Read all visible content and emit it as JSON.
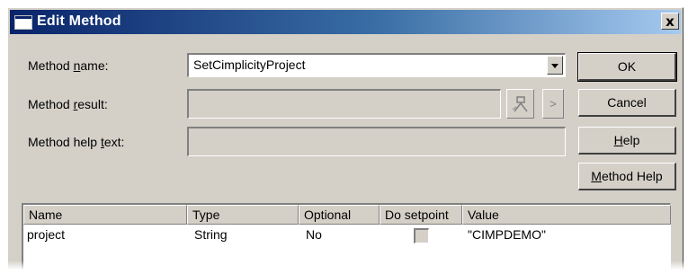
{
  "window": {
    "title": "Edit Method",
    "close_label": "x"
  },
  "form": {
    "method_name": {
      "label_pre": "Method ",
      "label_u": "n",
      "label_post": "ame:",
      "value": "SetCimplicityProject"
    },
    "method_result": {
      "label_pre": "Method ",
      "label_u": "r",
      "label_post": "esult:",
      "value": ""
    },
    "method_help_text": {
      "label_pre": "Method help ",
      "label_u": "t",
      "label_post": "ext:",
      "value": ""
    }
  },
  "buttons": {
    "ok": "OK",
    "cancel": "Cancel",
    "help_u": "H",
    "help_rest": "elp",
    "method_help_u": "M",
    "method_help_rest": "ethod Help",
    "next": ">"
  },
  "params_table": {
    "columns": [
      "Name",
      "Type",
      "Optional",
      "Do setpoint",
      "Value"
    ],
    "rows": [
      {
        "name": "project",
        "type": "String",
        "optional": "No",
        "do_setpoint": false,
        "value": "\"CIMPDEMO\""
      }
    ]
  },
  "colors": {
    "titlebar_start": "#0a246a",
    "titlebar_end": "#a6caf0",
    "dialog_bg": "#d4d0c8"
  }
}
